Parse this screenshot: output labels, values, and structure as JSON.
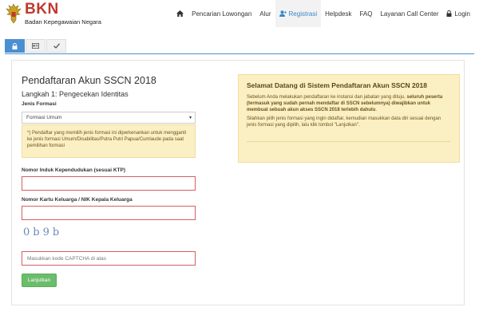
{
  "header": {
    "logo_title": "BKN",
    "logo_subtitle": "Badan Kepegawaian Negara"
  },
  "nav": {
    "home_icon": "home-icon",
    "items": [
      {
        "label": "Pencarian Lowongan"
      },
      {
        "label": "Alur"
      },
      {
        "label": "Registrasi",
        "icon": "user-plus-icon",
        "active": true
      },
      {
        "label": "Helpdesk"
      },
      {
        "label": "FAQ"
      },
      {
        "label": "Layanan Call Center"
      },
      {
        "label": "Login",
        "icon": "lock-icon"
      }
    ]
  },
  "tabs": [
    {
      "icon": "lock-icon",
      "active": true
    },
    {
      "icon": "id-card-icon"
    },
    {
      "icon": "check-icon"
    }
  ],
  "form": {
    "title": "Pendaftaran Akun SSCN 2018",
    "step": "Langkah 1: Pengecekan Identitas",
    "jenis_label": "Jenis Formasi",
    "jenis_value": "Formasi Umum",
    "note": "*) Pendaftar yang memilih jenis formasi ini diperkenankan untuk mengganti ke jenis formasi Umum/Disabilitas/Putra Putri Papua/Cumlaude pada saat pemilihan formasi",
    "nik_label": "Nomor Induk Kependudukan (sesuai KTP)",
    "kk_label": "Nomor Kartu Keluarga / NIK Kepala Keluarga",
    "captcha_text": "0b9b",
    "captcha_placeholder": "Masukkan kode CAPTCHA di atas",
    "submit_label": "Lanjutkan"
  },
  "welcome": {
    "title": "Selamat Datang di Sistem Pendaftaran Akun SSCN 2018",
    "text_pre": "Sebelum Anda melakukan pendaftaran ke instansi dan jabatan yang dituju, ",
    "text_bold": "seluruh peserta (termasuk yang sudah pernah mendaftar di SSCN sebelumnya) diwajibkan untuk membuat sebuah akun akses SSCN 2018 terlebih dahulu",
    "text_post": ".",
    "text2": "Silahkan pilih jenis formasi yang ingin didaftar, kemudian masukkan data diri sesuai dengan jenis formasi yang dipilih, lalu klik tombol \"Lanjutkan\"."
  },
  "colors": {
    "brand_red": "#c0392b",
    "accent_blue": "#4a8fd1",
    "notice_bg": "#fbefc4",
    "error_border": "#d46060",
    "button_green": "#6bbd6b"
  }
}
